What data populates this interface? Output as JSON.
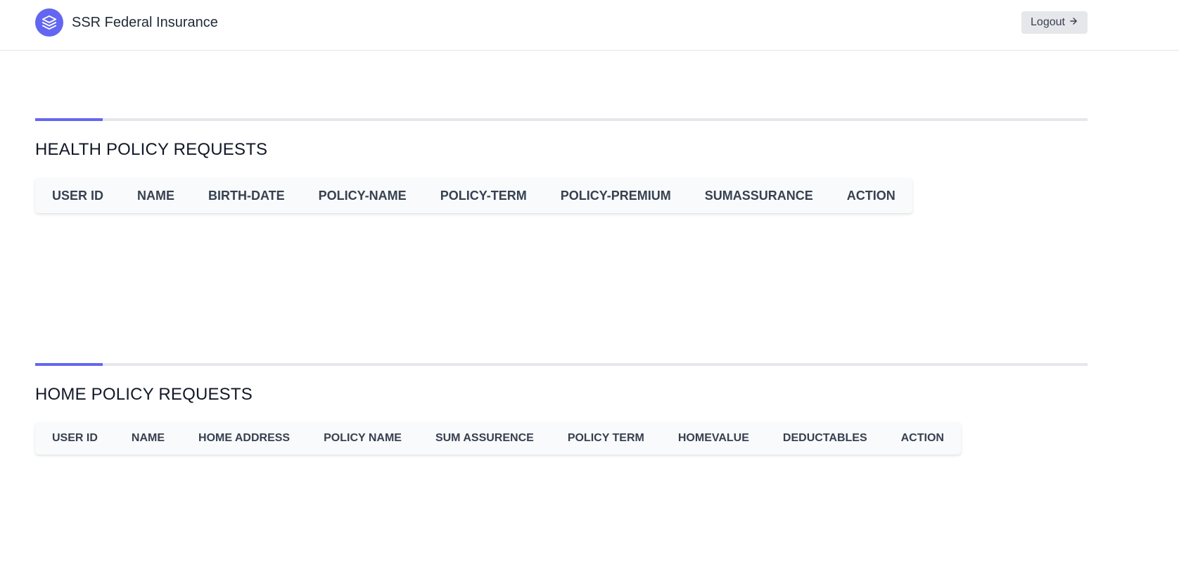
{
  "header": {
    "brand_name": "SSR Federal Insurance",
    "logo_icon": "layers-icon",
    "logout_label": "Logout",
    "logout_icon": "arrow-right-icon"
  },
  "colors": {
    "accent": "#6366f1",
    "divider": "#e5e7eb",
    "table_header_bg": "#f9fafb",
    "button_bg": "#e5e7eb"
  },
  "health_section": {
    "title": "HEALTH POLICY REQUESTS",
    "columns": [
      "USER ID",
      "NAME",
      "BIRTH-DATE",
      "POLICY-NAME",
      "POLICY-TERM",
      "POLICY-PREMIUM",
      "SUMASSURANCE",
      "ACTION"
    ],
    "rows": []
  },
  "home_section": {
    "title": "HOME POLICY REQUESTS",
    "columns": [
      "USER ID",
      "NAME",
      "HOME ADDRESS",
      "POLICY NAME",
      "SUM ASSURENCE",
      "POLICY TERM",
      "HOMEVALUE",
      "DEDUCTABLES",
      "ACTION"
    ],
    "rows": []
  }
}
